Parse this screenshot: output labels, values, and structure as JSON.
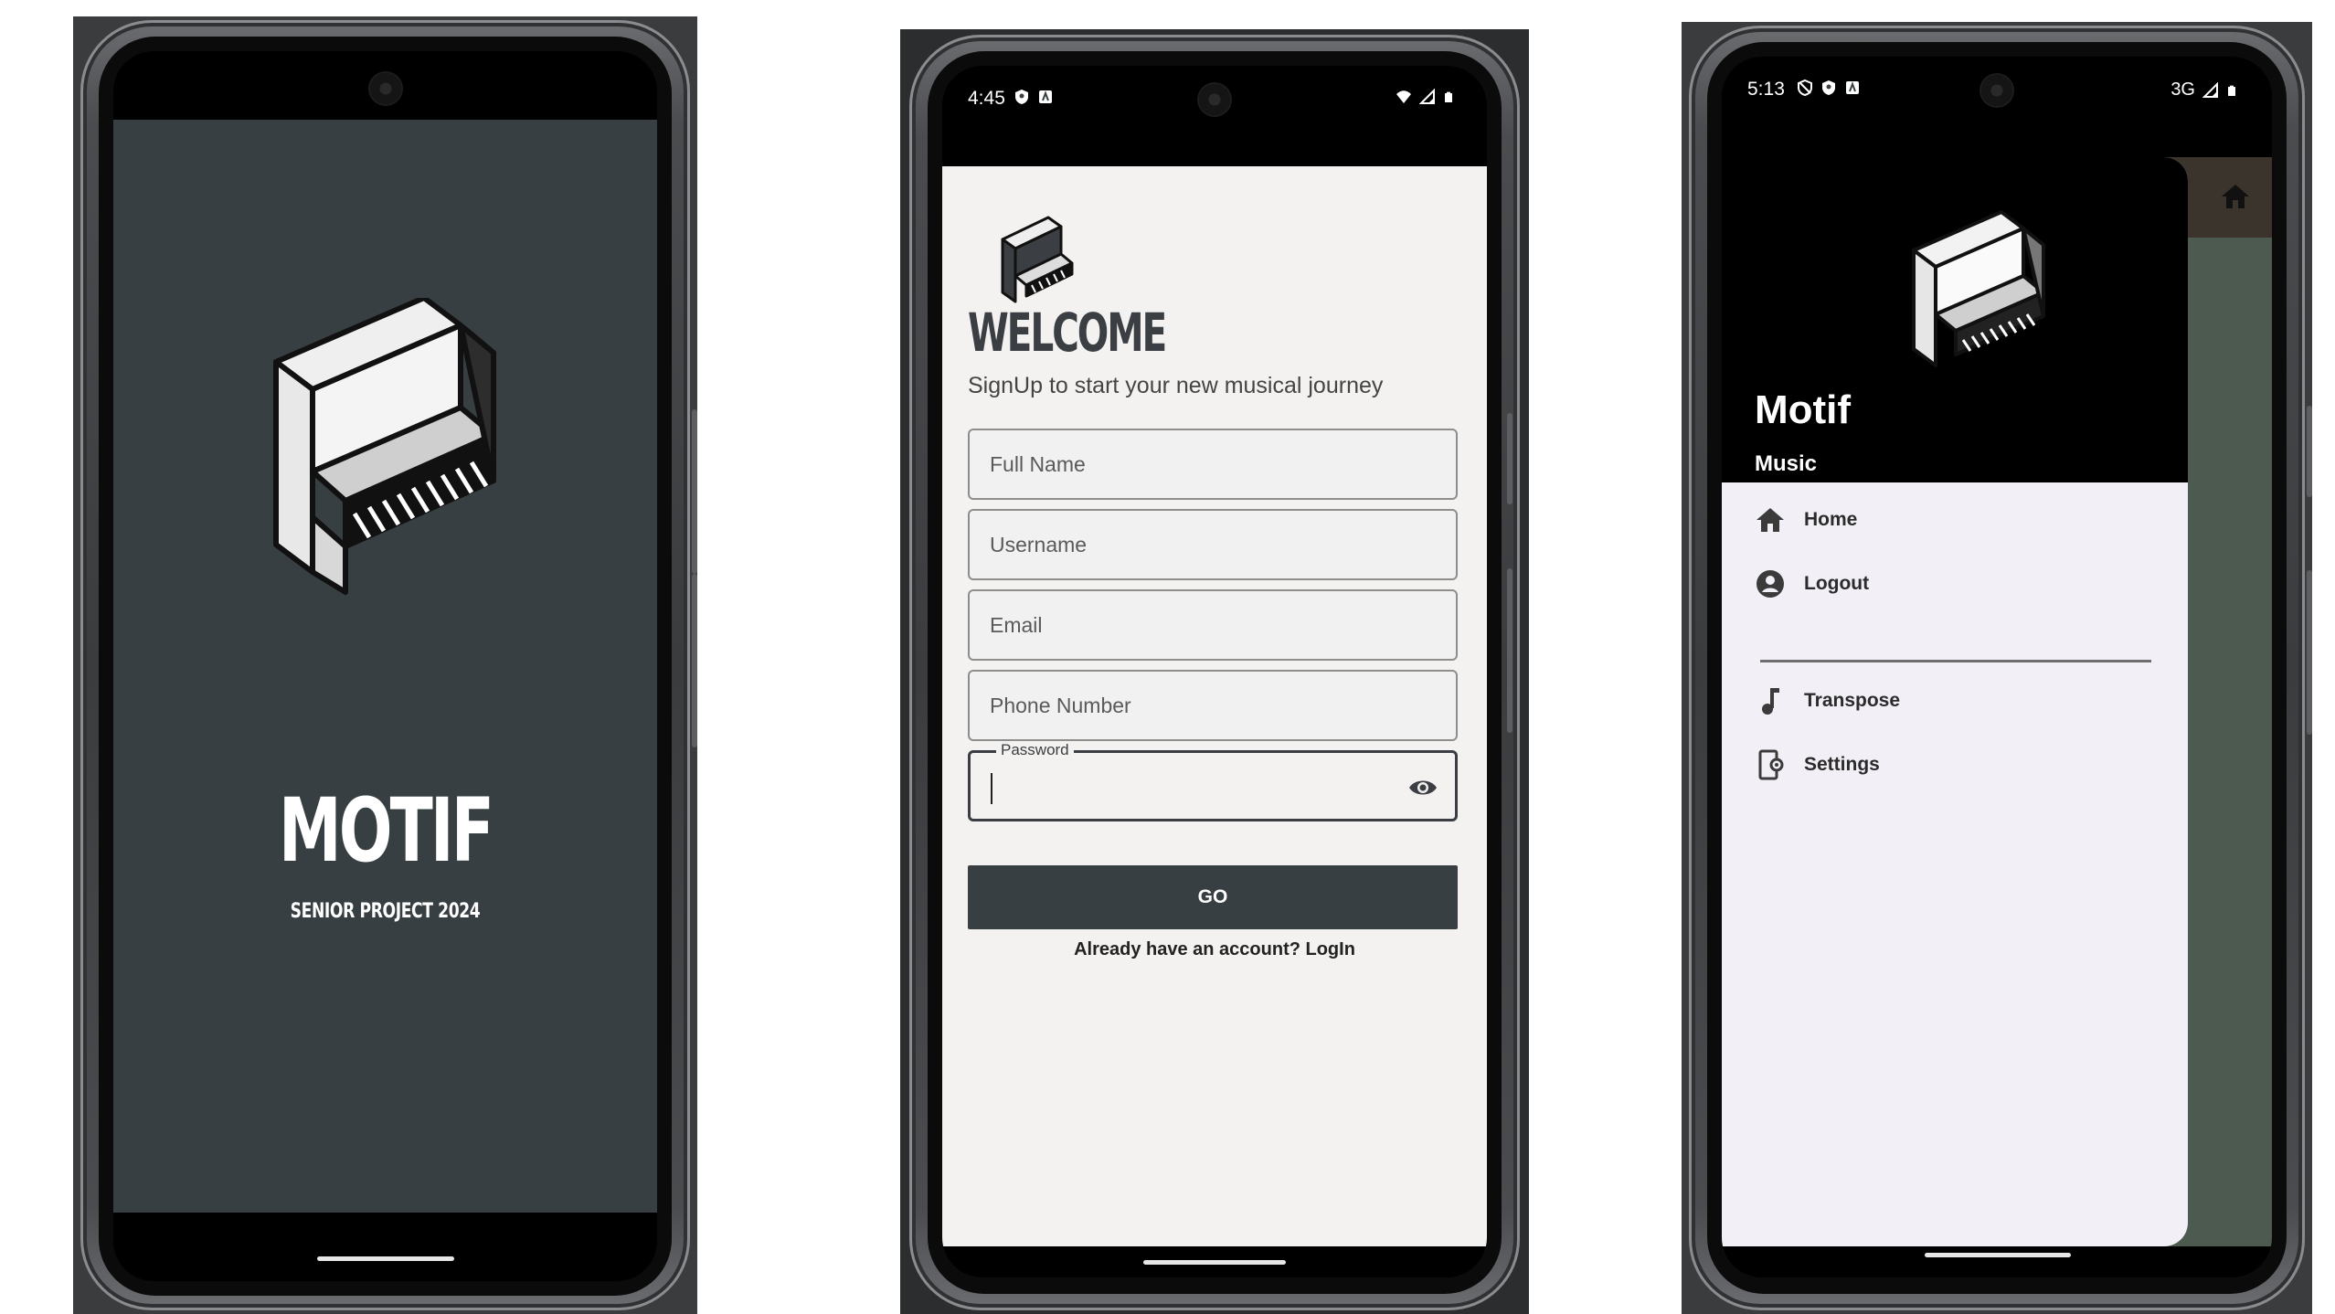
{
  "colors": {
    "splash_background": "#383f42",
    "signup_background": "#f3f2f0",
    "primary_button": "#383f42",
    "drawer_header": "#000000",
    "drawer_background": "#f2f0f6"
  },
  "splash": {
    "logo_icon": "piano-icon",
    "title": "MOTIF",
    "subtitle": "SENIOR PROJECT 2024"
  },
  "signup": {
    "status": {
      "time": "4:45",
      "icons": [
        "shield-icon",
        "a-icon",
        "wifi-icon",
        "signal-icon",
        "battery-icon"
      ]
    },
    "logo_icon": "piano-icon",
    "heading": "WELCOME",
    "subheading": "SignUp to start your new musical journey",
    "fields": {
      "full_name": "Full Name",
      "username": "Username",
      "email": "Email",
      "phone": "Phone Number",
      "password_label": "Password",
      "password_value": ""
    },
    "go_label": "GO",
    "login_text": "Already have an account? LogIn"
  },
  "drawer": {
    "status": {
      "time": "5:13",
      "network": "3G",
      "icons": [
        "vpn-shield-icon",
        "shield-icon",
        "a-icon",
        "signal-icon",
        "battery-icon"
      ]
    },
    "logo_icon": "piano-icon",
    "title": "Motif",
    "subtitle": "Music",
    "items": [
      {
        "icon": "home-icon",
        "label": "Home"
      },
      {
        "icon": "account-circle-icon",
        "label": "Logout"
      },
      {
        "icon": "music-note-icon",
        "label": "Transpose"
      },
      {
        "icon": "settings-phone-icon",
        "label": "Settings"
      }
    ],
    "appbar_icon": "home-icon"
  }
}
